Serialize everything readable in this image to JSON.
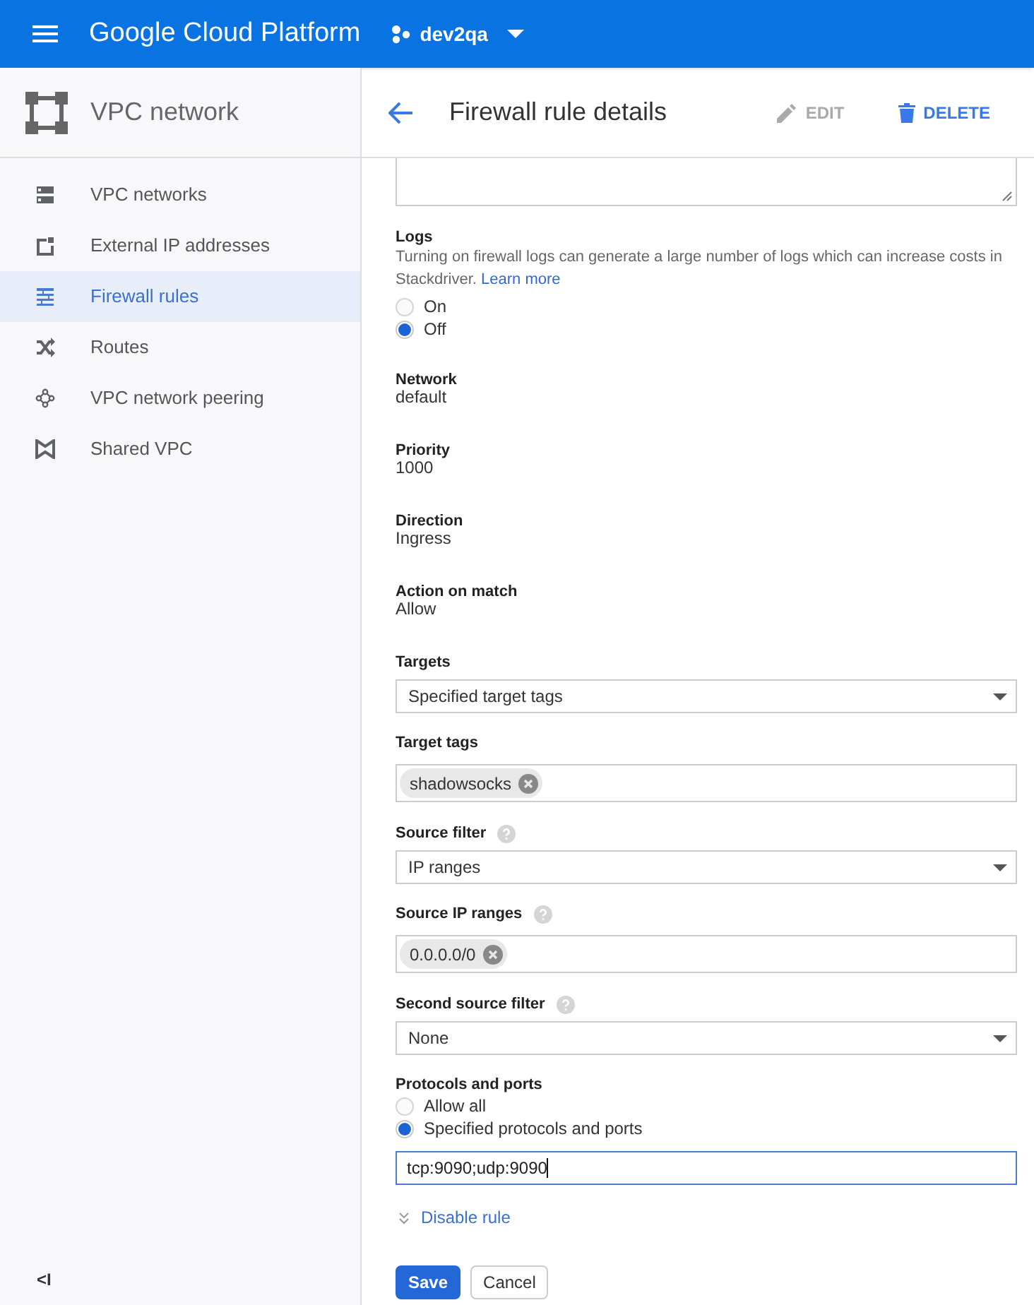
{
  "app_bar": {
    "title": "Google Cloud Platform",
    "project": "dev2qa"
  },
  "sidebar": {
    "title": "VPC network",
    "items": [
      {
        "label": "VPC networks",
        "selected": false
      },
      {
        "label": "External IP addresses",
        "selected": false
      },
      {
        "label": "Firewall rules",
        "selected": true
      },
      {
        "label": "Routes",
        "selected": false
      },
      {
        "label": "VPC network peering",
        "selected": false
      },
      {
        "label": "Shared VPC",
        "selected": false
      }
    ],
    "collapse": "<I"
  },
  "page_header": {
    "title": "Firewall rule details",
    "actions": [
      {
        "label": "EDIT",
        "disabled": true
      },
      {
        "label": "DELETE",
        "disabled": false
      }
    ]
  },
  "fields": [
    {
      "kind": "textarea"
    },
    {
      "kind": "radio",
      "label": "Logs",
      "description": "Turning on firewall logs can generate a large number of logs which can increase costs in Stackdriver.",
      "link": "Learn more",
      "options": [
        {
          "label": "On",
          "selected": false
        },
        {
          "label": "Off",
          "selected": true
        }
      ]
    },
    {
      "kind": "text",
      "label": "Network",
      "value": "default"
    },
    {
      "kind": "text",
      "label": "Priority",
      "value": "1000"
    },
    {
      "kind": "text",
      "label": "Direction",
      "value": "Ingress"
    },
    {
      "kind": "text",
      "label": "Action on match",
      "value": "Allow"
    },
    {
      "kind": "select",
      "label": "Targets",
      "help": false,
      "value": "Specified target tags"
    },
    {
      "kind": "tags",
      "label": "Target tags",
      "help": false,
      "tags": [
        "shadowsocks"
      ]
    },
    {
      "kind": "select",
      "label": "Source filter",
      "help": true,
      "value": "IP ranges"
    },
    {
      "kind": "tags",
      "label": "Source IP ranges",
      "help": true,
      "tags": [
        "0.0.0.0/0"
      ]
    },
    {
      "kind": "select",
      "label": "Second source filter",
      "help": true,
      "value": "None"
    },
    {
      "kind": "radio",
      "label": "Protocols and ports",
      "options": [
        {
          "label": "Allow all",
          "selected": false
        },
        {
          "label": "Specified protocols and ports",
          "selected": true
        }
      ]
    },
    {
      "kind": "input",
      "value": "tcp:9090;udp:9090",
      "focused": true
    }
  ],
  "toggle_link": "Disable rule",
  "buttons": [
    {
      "label": "Save",
      "primary": true
    },
    {
      "label": "Cancel",
      "primary": false
    }
  ]
}
